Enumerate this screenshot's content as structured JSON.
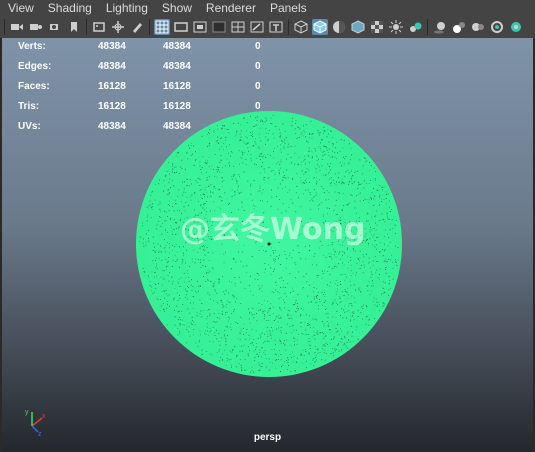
{
  "menubar": {
    "items": [
      "View",
      "Shading",
      "Lighting",
      "Show",
      "Renderer",
      "Panels"
    ]
  },
  "toolbar": {
    "icons": [
      "select-camera-icon",
      "camera-attributes-icon",
      "bookmark-camera-icon",
      "bookmark-icon",
      "image-plane-icon",
      "transform-tool-icon",
      "grease-pencil-icon",
      "grid-icon",
      "film-gate-icon",
      "resolution-gate-icon",
      "gate-mask-icon",
      "field-chart-icon",
      "safe-action-icon",
      "safe-title-icon",
      "wireframe-icon",
      "smooth-shade-icon",
      "wireframe-on-shaded-icon",
      "textured-icon",
      "use-all-lights-icon",
      "shadows-icon",
      "screen-space-ao-icon",
      "motion-blur-icon",
      "anti-aliasing-icon",
      "depth-of-field-icon",
      "isolate-select-icon"
    ]
  },
  "hud": {
    "rows": [
      {
        "label": "Verts:",
        "v1": "48384",
        "v2": "48384",
        "v3": "0"
      },
      {
        "label": "Edges:",
        "v1": "48384",
        "v2": "48384",
        "v3": "0"
      },
      {
        "label": "Faces:",
        "v1": "16128",
        "v2": "16128",
        "v3": "0"
      },
      {
        "label": "Tris:",
        "v1": "16128",
        "v2": "16128",
        "v3": "0"
      },
      {
        "label": "UVs:",
        "v1": "48384",
        "v2": "48384",
        "v3": "0"
      }
    ]
  },
  "viewport": {
    "watermark": "@玄冬Wong",
    "camera_label": "persp",
    "sphere_color": "#3df59c",
    "background_top": "#7f93a9",
    "background_bottom": "#24272c"
  }
}
